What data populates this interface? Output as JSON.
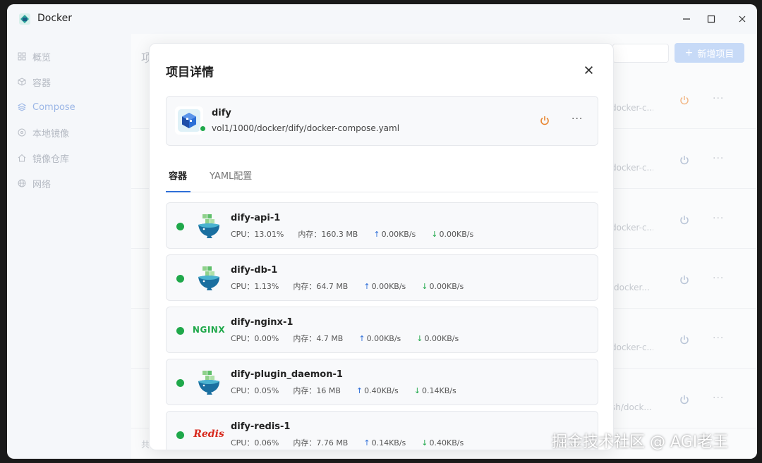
{
  "app": {
    "title": "Docker",
    "logo_icon": "docker-app-icon"
  },
  "window_controls": {
    "minimize": "—",
    "maximize": "☐",
    "close": "✕"
  },
  "sidebar": {
    "items": [
      {
        "label": "概览",
        "icon": "grid-icon",
        "active": false
      },
      {
        "label": "容器",
        "icon": "cube-icon",
        "active": false
      },
      {
        "label": "Compose",
        "icon": "layers-icon",
        "active": true
      },
      {
        "label": "本地镜像",
        "icon": "disc-icon",
        "active": false
      },
      {
        "label": "镜像仓库",
        "icon": "house-icon",
        "active": false
      },
      {
        "label": "网络",
        "icon": "globe-icon",
        "active": false
      }
    ]
  },
  "main": {
    "title_partial": "项",
    "add_button_label": "新增项目",
    "rows": [
      {
        "path_partial": "docker-c..."
      },
      {
        "path_partial": "docker-c..."
      },
      {
        "path_partial": "docker-c..."
      },
      {
        "path_partial": "/docker..."
      },
      {
        "path_partial": "docker-c..."
      },
      {
        "path_partial": "sh/dock..."
      }
    ],
    "footer_partial": "共"
  },
  "modal": {
    "title": "项目详情",
    "project": {
      "name": "dify",
      "path": "vol1/1000/docker/dify/docker-compose.yaml",
      "status_color": "#1fa84a"
    },
    "tabs": [
      {
        "label": "容器",
        "active": true
      },
      {
        "label": "YAML配置",
        "active": false
      }
    ],
    "containers": [
      {
        "name": "dify-api-1",
        "icon": "dify-whale-icon",
        "cpu_label": "CPU：",
        "cpu": "13.01%",
        "mem_label": "内存：",
        "mem": "160.3 MB",
        "up": "0.00KB/s",
        "down": "0.00KB/s"
      },
      {
        "name": "dify-db-1",
        "icon": "dify-whale-icon",
        "cpu_label": "CPU：",
        "cpu": "1.13%",
        "mem_label": "内存：",
        "mem": "64.7 MB",
        "up": "0.00KB/s",
        "down": "0.00KB/s"
      },
      {
        "name": "dify-nginx-1",
        "icon": "nginx-logo",
        "logo_text": "NGINX",
        "cpu_label": "CPU：",
        "cpu": "0.00%",
        "mem_label": "内存：",
        "mem": "4.7 MB",
        "up": "0.00KB/s",
        "down": "0.00KB/s"
      },
      {
        "name": "dify-plugin_daemon-1",
        "icon": "dify-whale-icon",
        "cpu_label": "CPU：",
        "cpu": "0.05%",
        "mem_label": "内存：",
        "mem": "16 MB",
        "up": "0.40KB/s",
        "down": "0.14KB/s"
      },
      {
        "name": "dify-redis-1",
        "icon": "redis-logo",
        "logo_text": "Redis",
        "cpu_label": "CPU：",
        "cpu": "0.06%",
        "mem_label": "内存：",
        "mem": "7.76 MB",
        "up": "0.14KB/s",
        "down": "0.40KB/s"
      }
    ]
  },
  "watermark": "掘金技术社区 @ AGI老王",
  "colors": {
    "accent": "#2f6fd8",
    "running": "#1fa84a",
    "power": "#e8852f",
    "redis": "#d82c20"
  }
}
